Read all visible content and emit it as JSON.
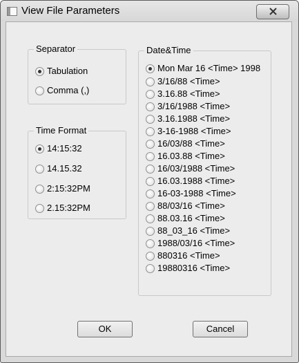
{
  "window": {
    "title": "View File Parameters"
  },
  "separator": {
    "title": "Separator",
    "options": [
      "Tabulation",
      "Comma (,)"
    ],
    "selected": 0
  },
  "time_format": {
    "title": "Time Format",
    "options": [
      "14:15:32",
      "14.15.32",
      "2:15:32PM",
      "2.15:32PM"
    ],
    "selected": 0
  },
  "date_time": {
    "title": "Date&Time",
    "options": [
      "Mon Mar 16 <Time> 1998",
      "3/16/88 <Time>",
      "3.16.88 <Time>",
      "3/16/1988 <Time>",
      "3.16.1988 <Time>",
      "3-16-1988 <Time>",
      "16/03/88 <Time>",
      "16.03.88 <Time>",
      "16/03/1988 <Time>",
      "16.03.1988 <Time>",
      "16-03-1988 <Time>",
      "88/03/16 <Time>",
      "88.03.16 <Time>",
      "88_03_16 <Time>",
      "1988/03/16 <Time>",
      "880316 <Time>",
      "19880316 <Time>"
    ],
    "selected": 0
  },
  "buttons": {
    "ok": "OK",
    "cancel": "Cancel"
  },
  "colors": {
    "window_bg": "#d9d9d9",
    "client_bg": "#ececec",
    "group_border": "#c9c9c9"
  }
}
